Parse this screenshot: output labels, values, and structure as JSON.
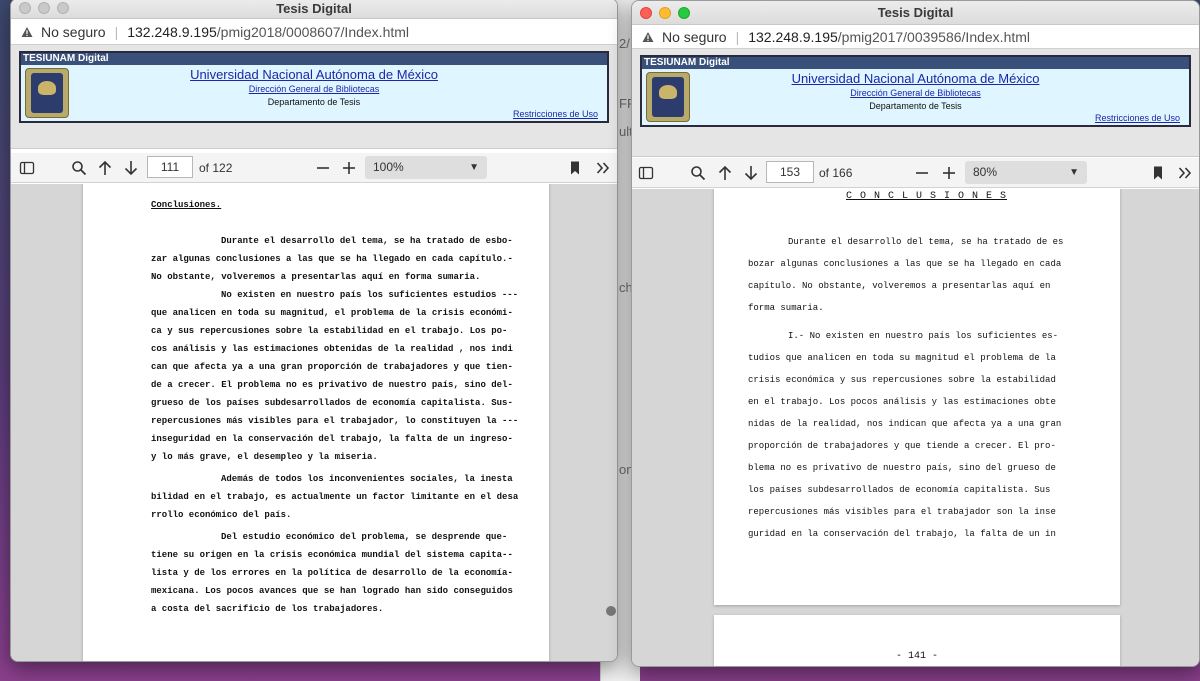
{
  "background_app": {
    "fragments": [
      "2/",
      "FF",
      "ulti",
      "cho",
      "on"
    ]
  },
  "left_window": {
    "title": "Tesis Digital",
    "url": {
      "security": "No seguro",
      "host": "132.248.9.195",
      "path": "/pmig2018/0008607/Index.html"
    },
    "banner": {
      "header": "TESIUNAM Digital",
      "university": "Universidad Nacional Autónoma de México",
      "directorate": "Dirección General de Bibliotecas",
      "department": "Departamento de Tesis",
      "restrictions": "Restricciones de Uso"
    },
    "pdf_toolbar": {
      "page": "111",
      "of_pages": "of 122",
      "zoom": "100%",
      "zoom_fraction": 1.0
    },
    "page_text": [
      "Conclusiones.",
      "Durante el desarrollo del tema, se ha tratado de esbo-",
      "zar algunas conclusiones a las que se ha llegado en cada capítulo.-",
      "No obstante, volveremos a presentarlas aquí en forma sumaria.",
      "No existen en nuestro país los suficientes estudios ---",
      "que analicen en toda su magnitud, el problema de la crisis económi-",
      "ca y sus repercusiones sobre la estabilidad en el trabajo. Los po-",
      "cos análisis y las estimaciones obtenidas de la realidad , nos indi",
      "can que afecta ya a una gran proporción de trabajadores y que tien-",
      "de a crecer. El problema no es privativo de nuestro país, sino del-",
      "grueso de los países subdesarrollados de economía capitalista. Sus-",
      "repercusiones más visibles para el trabajador, lo constituyen la ---",
      "inseguridad en la conservación del trabajo, la falta de un ingreso-",
      "y lo más grave, el desempleo y la miseria.",
      "Además de todos los inconvenientes sociales, la inesta",
      "bilidad en el trabajo, es actualmente un factor limitante en el desa",
      "rrollo económico del país.",
      "Del estudio económico del problema, se desprende que-",
      "tiene su origen en la crisis económica mundial del sistema capita--",
      "lista y de los errores en la política de desarrollo de la economía-",
      "mexicana. Los pocos avances que se han logrado han sido conseguidos",
      "a costa del sacrificio de los trabajadores."
    ]
  },
  "right_window": {
    "title": "Tesis Digital",
    "url": {
      "security": "No seguro",
      "host": "132.248.9.195",
      "path": "/pmig2017/0039586/Index.html"
    },
    "banner": {
      "header": "TESIUNAM Digital",
      "university": "Universidad Nacional Autónoma de México",
      "directorate": "Dirección General de Bibliotecas",
      "department": "Departamento de Tesis",
      "restrictions": "Restricciones de Uso"
    },
    "pdf_toolbar": {
      "page": "153",
      "of_pages": "of 166",
      "zoom": "80%",
      "zoom_fraction": 0.8
    },
    "page_heading": "C O N C L U S I O N E S",
    "page_text": [
      "Durante el desarrollo del tema, se ha tratado de es",
      "bozar algunas conclusiones a las que se ha llegado en cada",
      "capítulo.  No obstante, volveremos a presentarlas aquí en",
      "forma sumaria.",
      "I.-  No existen en nuestro país los suficientes es-",
      "tudios que analicen en toda su magnitud el problema de la",
      "crisis económica y sus repercusiones sobre la estabilidad",
      "en el trabajo.  Los pocos análisis y las estimaciones obte",
      "nidas de la realidad, nos indican que afecta ya a una gran",
      "proporción de trabajadores y que tiende a crecer.  El pro-",
      "blema no es privativo de nuestro país, sino del grueso de",
      "los países subdesarrollados de economía capitalista.  Sus",
      "repercusiones más visibles para el trabajador son la inse",
      "guridad en la conservación del trabajo, la falta de un in"
    ],
    "next_page_number": "- 141 -"
  }
}
